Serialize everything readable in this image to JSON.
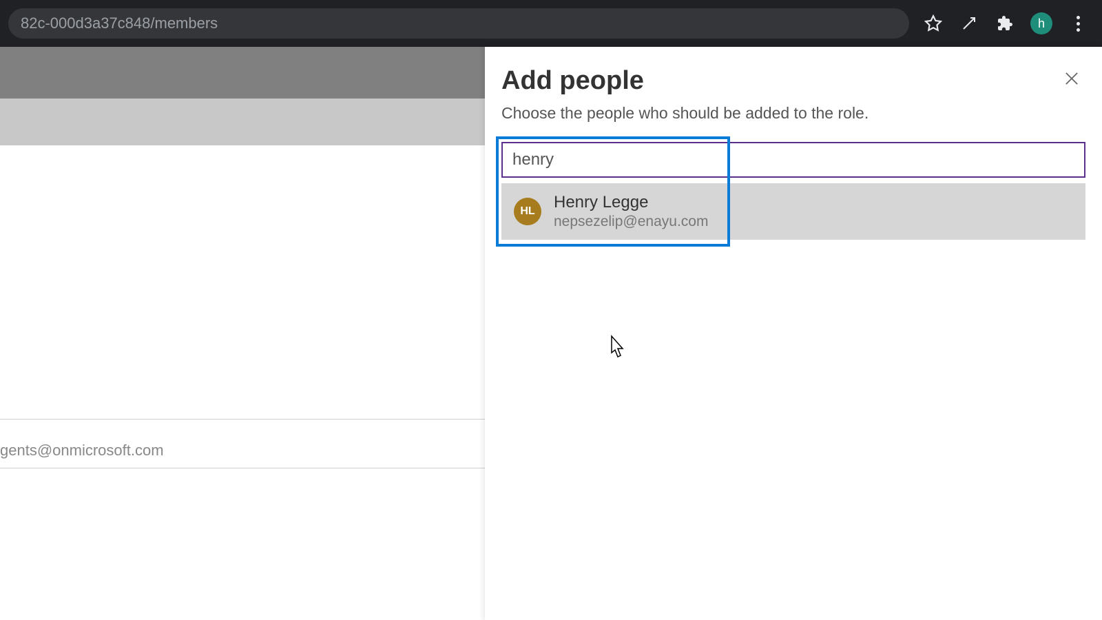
{
  "browser": {
    "url_fragment": "82c-000d3a37c848/members",
    "profile_letter": "h"
  },
  "background": {
    "partial_email": "gents@onmicrosoft.com"
  },
  "panel": {
    "title": "Add people",
    "subtitle": "Choose the people who should be added to the role.",
    "search_value": "henry",
    "suggestion": {
      "initials": "HL",
      "name": "Henry Legge",
      "email": "nepsezelip@enayu.com"
    }
  }
}
